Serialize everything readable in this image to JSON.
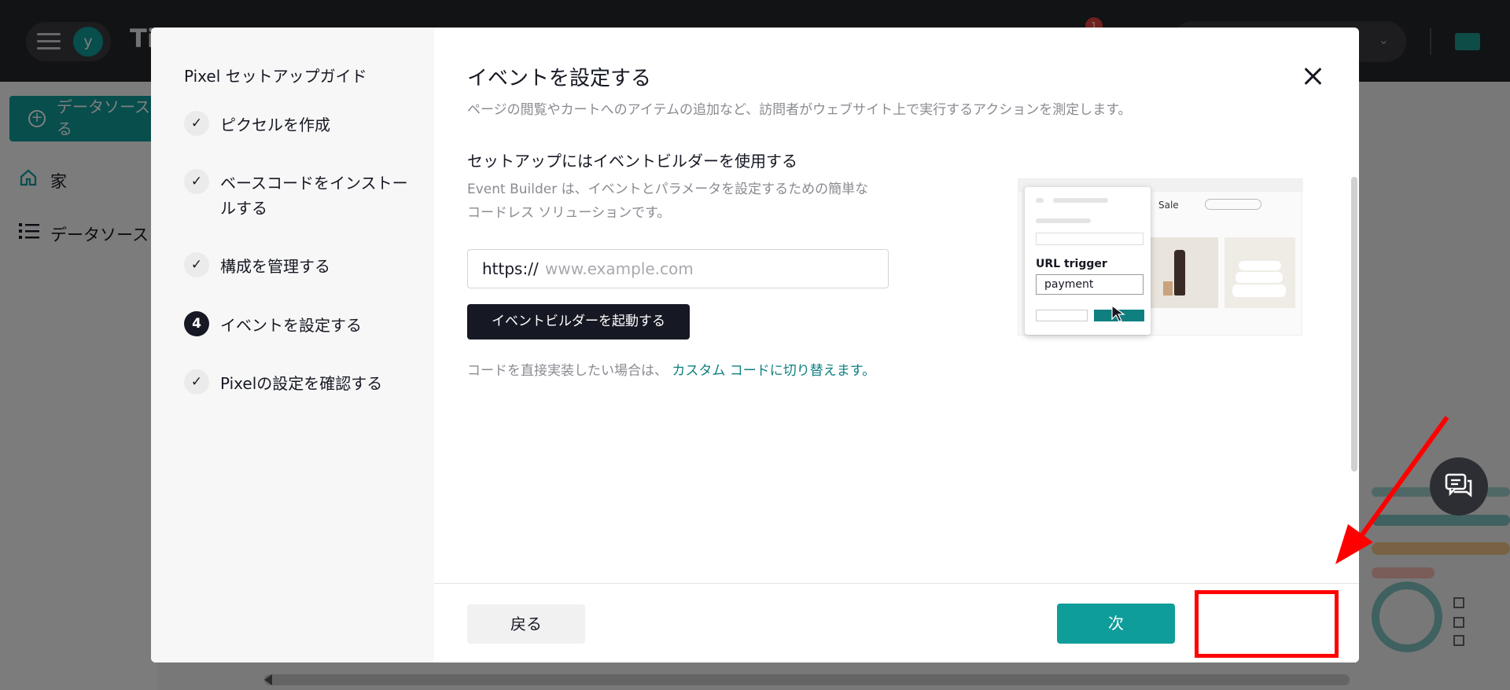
{
  "app": {
    "avatar_letter": "y",
    "brand": "Ti",
    "notification_count": "1"
  },
  "sidebar": {
    "add_button": "データソース\nる",
    "items": [
      {
        "label": "家",
        "icon": "home-icon"
      },
      {
        "label": "データソース",
        "icon": "list-icon"
      }
    ]
  },
  "modal": {
    "guide_title": "Pixel セットアップガイド",
    "steps": [
      {
        "label": "ピクセルを作成",
        "status": "done"
      },
      {
        "label": "ベースコードをインストールする",
        "status": "done"
      },
      {
        "label": "構成を管理する",
        "status": "done"
      },
      {
        "label": "イベントを設定する",
        "status": "active",
        "number": "4"
      },
      {
        "label": "Pixelの設定を確認する",
        "status": "done"
      }
    ],
    "title": "イベントを設定する",
    "subtitle": "ページの閲覧やカートへのアイテムの追加など、訪問者がウェブサイト上で実行するアクションを測定します。",
    "section_heading": "セットアップにはイベントビルダーを使用する",
    "section_desc_1": "Event Builder は、イベントとパラメータを設定するための簡単な",
    "section_desc_2": "コードレス ソリューションです。",
    "url_prefix": "https://",
    "url_placeholder": "www.example.com",
    "launch_button": "イベントビルダーを起動する",
    "switch_text": "コードを直接実装したい場合は、",
    "switch_link": "カスタム コードに切り替えます。",
    "preview": {
      "nav_label": "Sale",
      "trigger_label": "URL trigger",
      "trigger_value": "payment"
    },
    "back_button": "戻る",
    "next_button": "次"
  },
  "colors": {
    "accent": "#0f9d9a",
    "link": "#0f7f80",
    "annotation": "#ff0000"
  }
}
